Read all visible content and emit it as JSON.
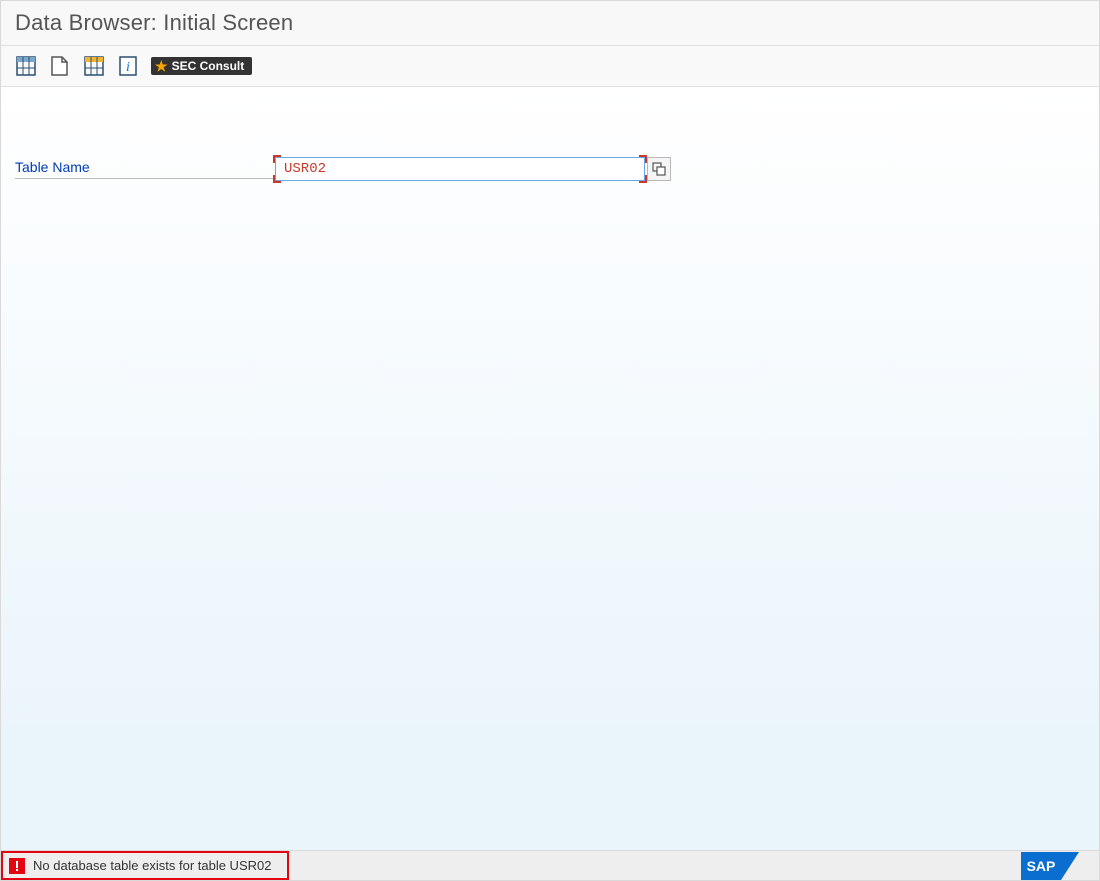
{
  "header": {
    "title": "Data Browser: Initial Screen"
  },
  "toolbar": {
    "icons": {
      "table_contents": "table-contents-icon",
      "create": "create-icon",
      "table_display": "table-display-icon",
      "info": "info-icon"
    },
    "sec_consult_label": "SEC Consult"
  },
  "form": {
    "table_name_label": "Table Name",
    "table_name_value": "USR02",
    "f4_help_tooltip": "Possible Entries"
  },
  "status": {
    "message": "No database table exists for table USR02"
  },
  "footer": {
    "logo_text": "SAP"
  },
  "colors": {
    "accent": "#0a6ed1",
    "error": "#e20613",
    "link": "#003bb5",
    "input_value": "#c7392b"
  }
}
